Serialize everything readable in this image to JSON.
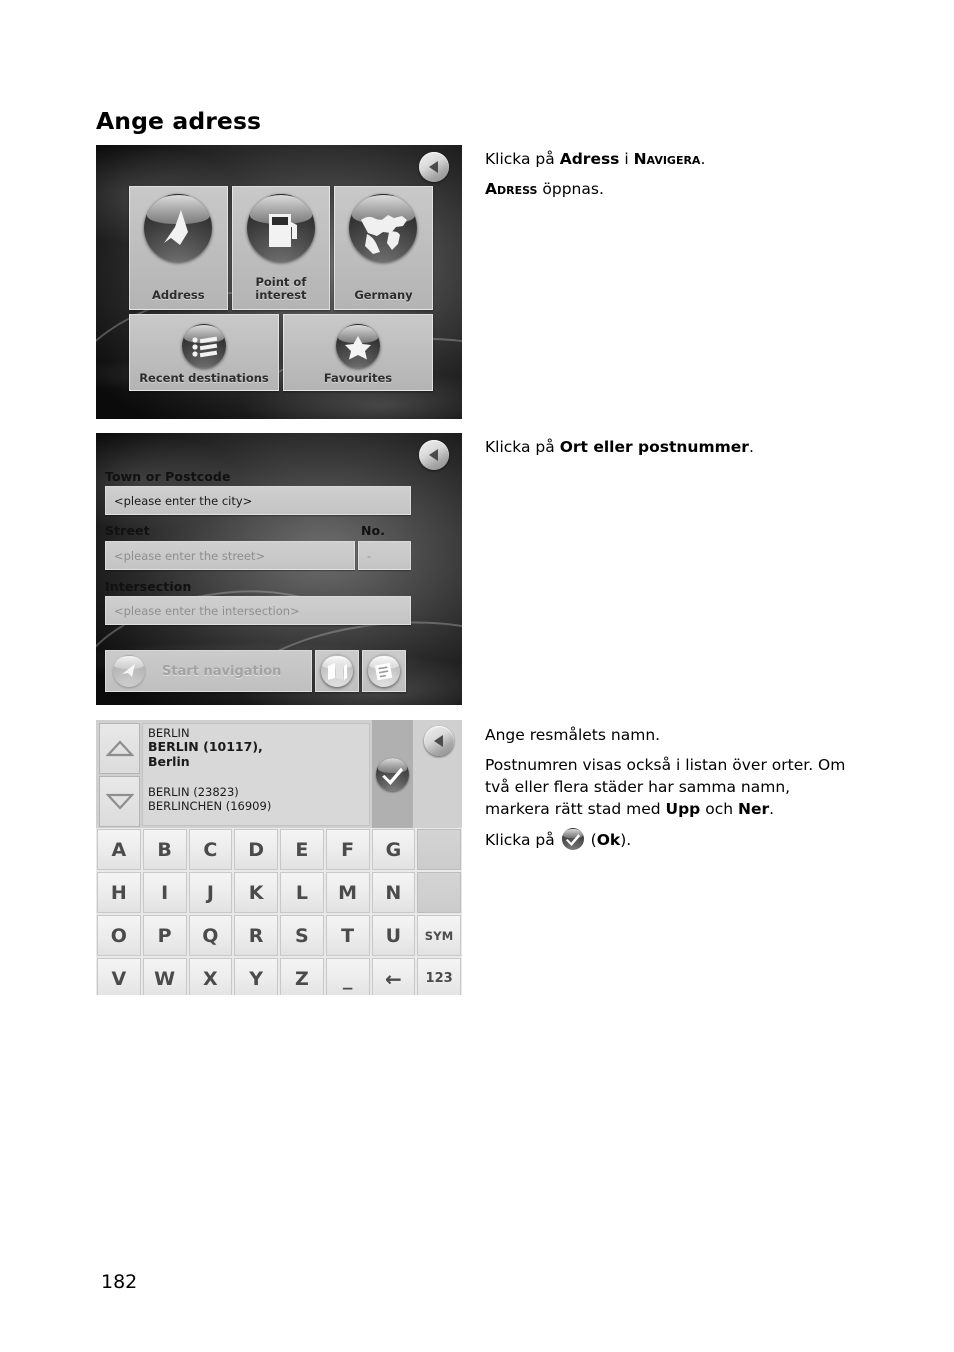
{
  "page": {
    "title": "Ange adress",
    "number": "182"
  },
  "screens": {
    "navigate_menu": {
      "back_button": "back-arrow",
      "tiles_row1": [
        {
          "label": "Address",
          "icon": "address-flag-icon"
        },
        {
          "label": "Point of\ninterest",
          "icon": "fuel-pump-icon"
        },
        {
          "label": "Germany",
          "icon": "globe-icon"
        }
      ],
      "tiles_row2": [
        {
          "label": "Recent destinations",
          "icon": "list-icon"
        },
        {
          "label": "Favourites",
          "icon": "star-icon"
        }
      ]
    },
    "address_form": {
      "back_button": "back-arrow",
      "town_label": "Town or Postcode",
      "town_value": "<please enter the city>",
      "street_label": "Street",
      "no_label": "No.",
      "street_value": "<please enter the street>",
      "no_value": "-",
      "intersection_label": "Intersection",
      "intersection_value": "<please enter the intersection>",
      "start_navigation_label": "Start navigation",
      "map_button": "map-icon",
      "save_button": "save-destination-icon"
    },
    "city_keyboard": {
      "back_button": "back-arrow",
      "scroll_up": "triangle-up-icon",
      "scroll_down": "triangle-down-icon",
      "list": [
        {
          "text": "BERLIN",
          "selected": false
        },
        {
          "text": "BERLIN (10117),",
          "selected": true
        },
        {
          "text": "Berlin",
          "selected": true
        },
        {
          "text": "BERLIN (23823)",
          "selected": false
        },
        {
          "text": "BERLINCHEN (16909)",
          "selected": false
        }
      ],
      "ok_button": "checkmark-ok-icon",
      "keyboard_rows": [
        [
          "A",
          "B",
          "C",
          "D",
          "E",
          "F",
          "G",
          ""
        ],
        [
          "H",
          "I",
          "J",
          "K",
          "L",
          "M",
          "N",
          ""
        ],
        [
          "O",
          "P",
          "Q",
          "R",
          "S",
          "T",
          "U",
          "SYM"
        ],
        [
          "V",
          "W",
          "X",
          "Y",
          "Z",
          "_",
          "←",
          "123"
        ]
      ]
    }
  },
  "notes": {
    "note1": {
      "line1_pre": "Klicka på ",
      "line1_bold1": "Adress",
      "line1_mid": " i ",
      "line1_sc1": "Navigera",
      "line1_post": ".",
      "line2_sc": "Adress",
      "line2_post": " öppnas."
    },
    "note2": {
      "pre": "Klicka på ",
      "bold": "Ort eller postnummer",
      "post": "."
    },
    "note3": {
      "p1": "Ange resmålets namn.",
      "p2_a": "Postnumren visas också i listan över orter. Om två eller flera städer har samma namn, markera rätt stad med ",
      "p2_b1": "Upp",
      "p2_mid": " och ",
      "p2_b2": "Ner",
      "p2_end": ".",
      "p3_pre": "Klicka på ",
      "p3_open": " (",
      "p3_bold": "Ok",
      "p3_close": ")."
    }
  },
  "colors": {
    "page_bg": "#ffffff",
    "text": "#000000",
    "screen_dark": "#2a2a2a",
    "tile_grey": "#c2c2c2",
    "key_grey": "#ededed",
    "key_text": "#4b4b4b",
    "list_bg": "#d8d8d8",
    "ok_cell": "#b0b0b0"
  }
}
